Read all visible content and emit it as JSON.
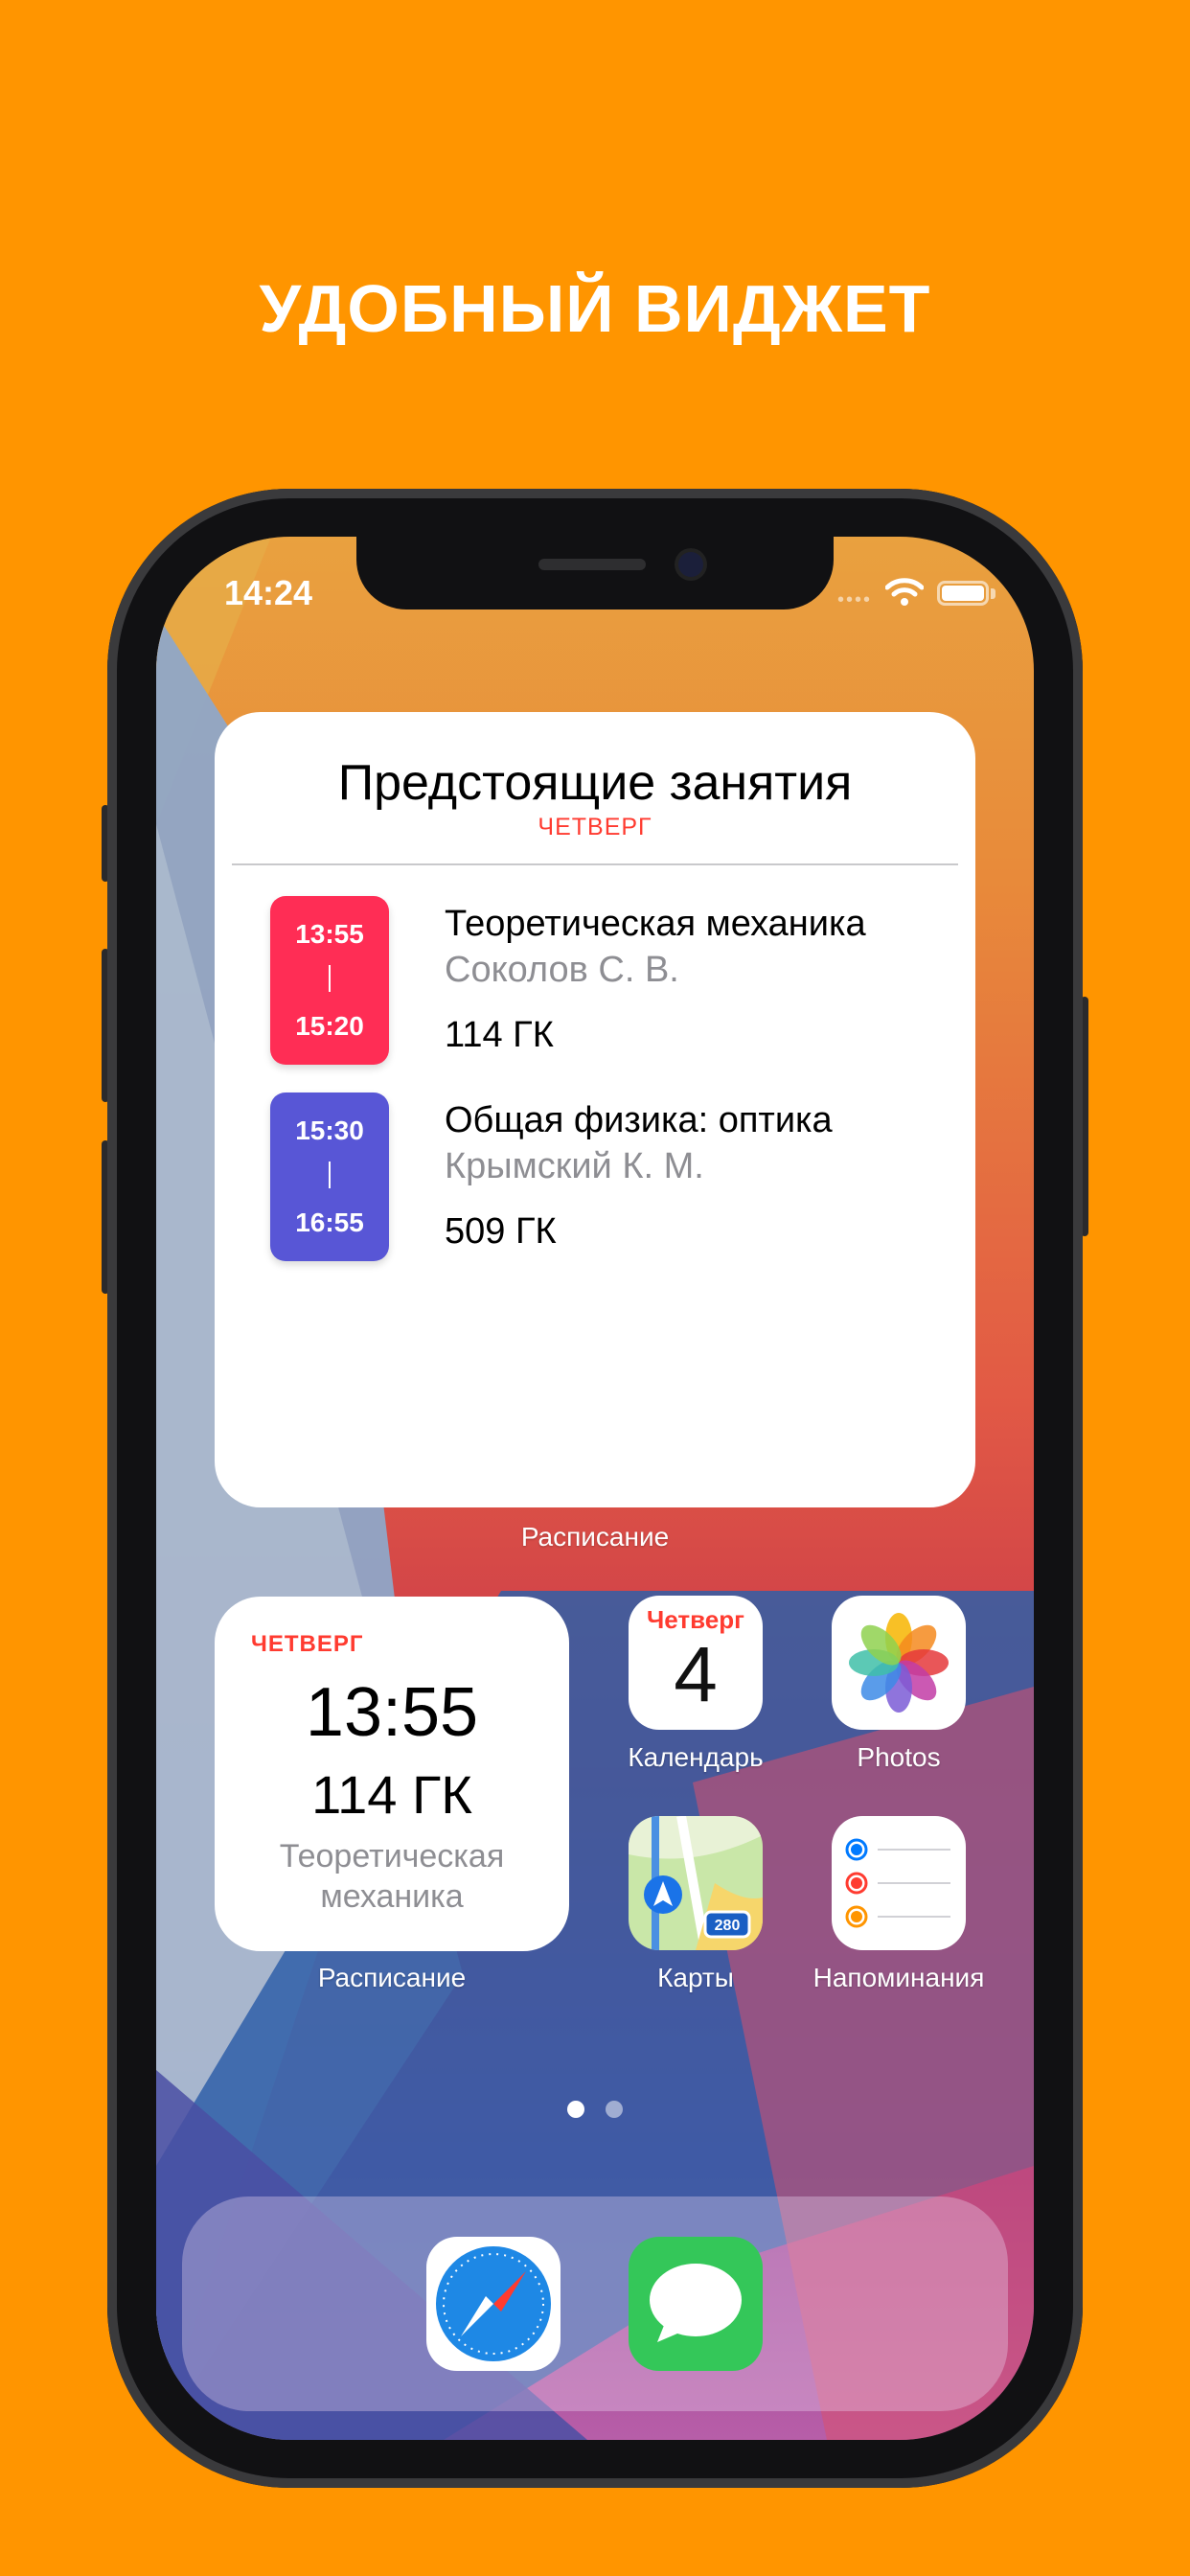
{
  "promo": {
    "headline": "УДОБНЫЙ ВИДЖЕТ"
  },
  "status_bar": {
    "time": "14:24",
    "icons": [
      "cellular-icon",
      "wifi-icon",
      "battery-icon"
    ]
  },
  "large_widget": {
    "title": "Предстоящие занятия",
    "day": "ЧЕТВЕРГ",
    "app_label": "Расписание",
    "lessons": [
      {
        "start": "13:55",
        "sep": "|",
        "end": "15:20",
        "name": "Теоретическая механика",
        "teacher": "Соколов С. В.",
        "room": "114 ГК",
        "color": "#ff2d55"
      },
      {
        "start": "15:30",
        "sep": "|",
        "end": "16:55",
        "name": "Общая физика: оптика",
        "teacher": "Крымский К. М.",
        "room": "509 ГК",
        "color": "#5856d6"
      }
    ]
  },
  "small_widget": {
    "day": "ЧЕТВЕРГ",
    "time": "13:55",
    "room": "114 ГК",
    "name": "Теоретическая механика",
    "app_label": "Расписание"
  },
  "apps": [
    {
      "label": "Календарь",
      "icon": "calendar-icon",
      "day": "Четверг",
      "date": "4"
    },
    {
      "label": "Photos",
      "icon": "photos-icon"
    },
    {
      "label": "Карты",
      "icon": "maps-icon",
      "badge": "280"
    },
    {
      "label": "Напоминания",
      "icon": "reminders-icon"
    }
  ],
  "page_indicator": {
    "pages": 2,
    "current": 1
  },
  "dock": [
    {
      "icon": "safari-icon"
    },
    {
      "icon": "messages-icon"
    }
  ],
  "colors": {
    "background": "#ff9500",
    "accent_red": "#ff3b30",
    "lesson1": "#ff2d55",
    "lesson2": "#5856d6"
  }
}
